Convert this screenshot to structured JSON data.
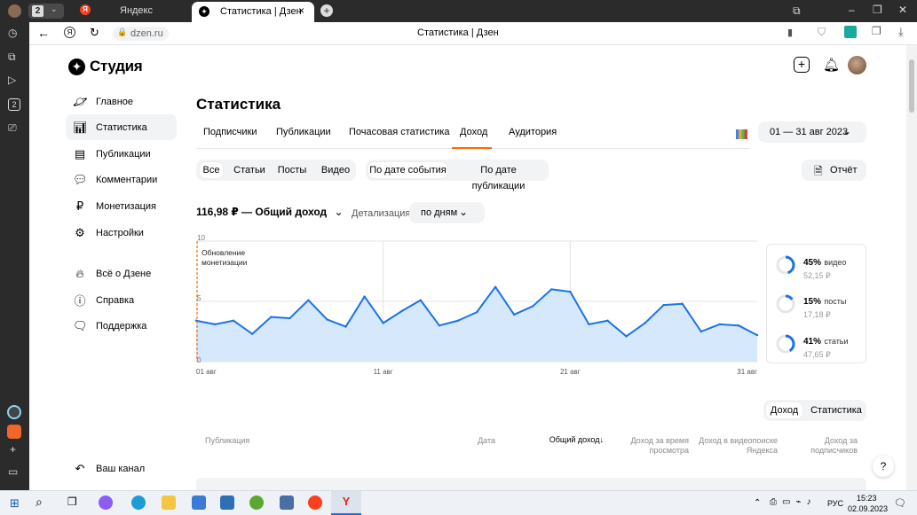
{
  "browser": {
    "tab_count": "2",
    "tabs": [
      {
        "label": "Яндекс"
      },
      {
        "label": "Статистика | Дзен"
      }
    ],
    "address": "dzen.ru",
    "page_title": "Статистика | Дзен"
  },
  "studio": {
    "logo": "Студия",
    "sidebar": [
      {
        "label": "Главное",
        "icon": "planet-icon"
      },
      {
        "label": "Статистика",
        "icon": "bar-chart-icon"
      },
      {
        "label": "Публикации",
        "icon": "layers-icon"
      },
      {
        "label": "Комментарии",
        "icon": "comment-icon"
      },
      {
        "label": "Монетизация",
        "icon": "ruble-icon"
      },
      {
        "label": "Настройки",
        "icon": "gear-icon"
      },
      {
        "label": "Всё о Дзене",
        "icon": "flame-icon"
      },
      {
        "label": "Справка",
        "icon": "help-icon"
      },
      {
        "label": "Поддержка",
        "icon": "chat-icon"
      }
    ],
    "your_channel": "Ваш канал",
    "page_heading": "Статистика",
    "tabs": [
      "Подписчики",
      "Публикации",
      "Почасовая статистика",
      "Доход",
      "Аудитория"
    ],
    "active_tab": "Доход",
    "date_range": "01 — 31 авг 2023",
    "filter_type": [
      "Все",
      "Статьи",
      "Посты",
      "Видео"
    ],
    "filter_date": [
      "По дате события",
      "По дате публикации"
    ],
    "report_button": "Отчёт",
    "total": "116,98 ₽ — Общий доход",
    "detail_label": "Детализация",
    "detail_value": "по дням",
    "annotation": "Обновление монетизации",
    "legend": [
      {
        "pct": "45%",
        "label": "видео",
        "sum": "52,15 ₽",
        "fraction": 0.45
      },
      {
        "pct": "15%",
        "label": "посты",
        "sum": "17,18 ₽",
        "fraction": 0.15
      },
      {
        "pct": "41%",
        "label": "статьи",
        "sum": "47,65 ₽",
        "fraction": 0.41
      }
    ],
    "table_toggle": [
      "Доход",
      "Статистика"
    ],
    "columns": [
      "Публикация",
      "Дата",
      "Общий доход",
      "Доход за время просмотра",
      "Доход в видеопоиске Яндекса",
      "Доход за подписчиков"
    ],
    "help": "?"
  },
  "taskbar": {
    "lang": "РУС",
    "time": "15:23",
    "date": "02.09.2023"
  },
  "colors": {
    "accent": "#ff6a00",
    "line": "#1a73e8",
    "fill": "#d6e8fb"
  },
  "chart_data": {
    "type": "area",
    "x": [
      "01 авг",
      "02 авг",
      "03 авг",
      "04 авг",
      "05 авг",
      "06 авг",
      "07 авг",
      "08 авг",
      "09 авг",
      "10 авг",
      "11 авг",
      "12 авг",
      "13 авг",
      "14 авг",
      "15 авг",
      "16 авг",
      "17 авг",
      "18 авг",
      "19 авг",
      "20 авг",
      "21 авг",
      "22 авг",
      "23 авг",
      "24 авг",
      "25 авг",
      "26 авг",
      "27 авг",
      "28 авг",
      "29 авг",
      "30 авг",
      "31 авг"
    ],
    "values": [
      3.4,
      3.1,
      3.4,
      2.3,
      3.7,
      3.6,
      5.1,
      3.5,
      2.9,
      5.4,
      3.2,
      4.2,
      5.1,
      3.0,
      3.4,
      4.1,
      6.2,
      3.9,
      4.6,
      6.0,
      5.8,
      3.1,
      3.4,
      2.1,
      3.2,
      4.7,
      4.8,
      2.5,
      3.1,
      3.0,
      2.2
    ],
    "x_ticks": [
      "01 авг",
      "11 авг",
      "21 авг",
      "31 авг"
    ],
    "y_ticks": [
      "0",
      "5",
      "10"
    ],
    "ylim": [
      0,
      10
    ]
  }
}
